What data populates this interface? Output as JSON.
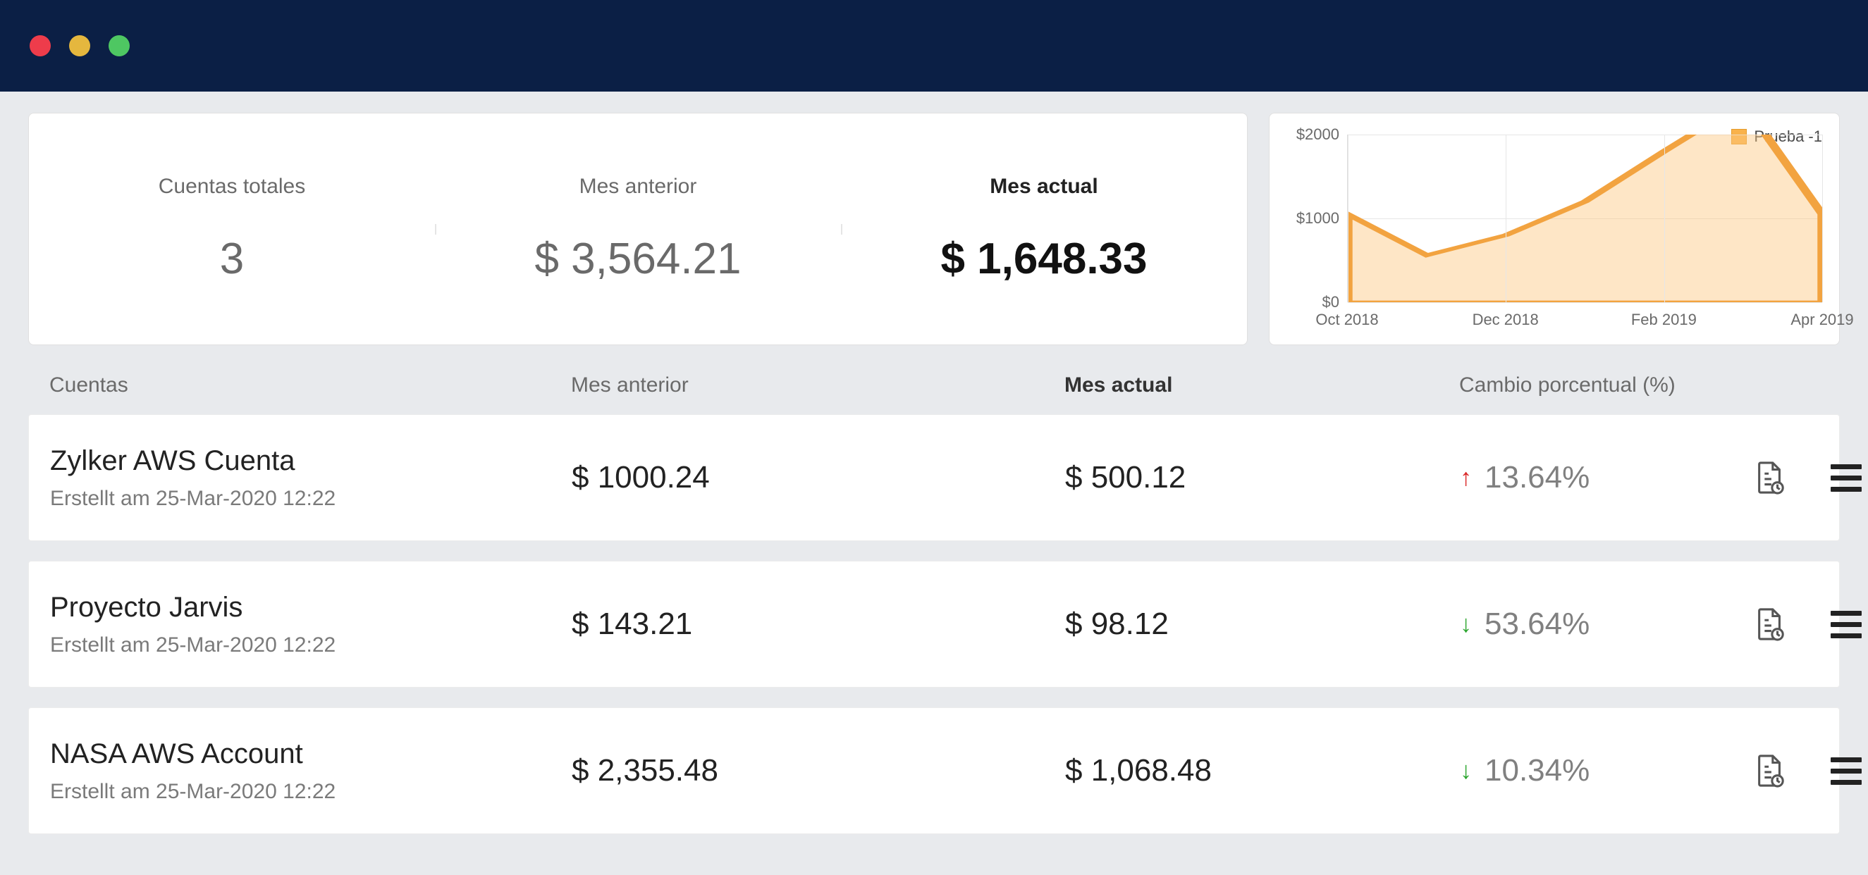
{
  "summary": {
    "total_label": "Cuentas totales",
    "total_value": "3",
    "prev_label": "Mes anterior",
    "prev_value": "$ 3,564.21",
    "curr_label": "Mes actual",
    "curr_value": "$ 1,648.33"
  },
  "chart_data": {
    "type": "area",
    "title": "",
    "xlabel": "",
    "ylabel": "",
    "legend": "Prueba -1",
    "y_ticks": [
      "$0",
      "$1000",
      "$2000"
    ],
    "ylim": [
      0,
      2000
    ],
    "categories": [
      "Oct 2018",
      "Dec 2018",
      "Feb 2019",
      "Apr 2019"
    ],
    "series": [
      {
        "name": "Prueba -1",
        "x": [
          "Oct 2018",
          "Nov 2018",
          "Dec 2018",
          "Jan 2019",
          "Feb 2019",
          "Mar 2019",
          "Apr 2019"
        ],
        "values": [
          1050,
          560,
          800,
          1200,
          1800,
          2380,
          1050
        ]
      }
    ]
  },
  "table": {
    "headers": {
      "accounts": "Cuentas",
      "prev": "Mes anterior",
      "curr": "Mes actual",
      "pct": "Cambio porcentual (%)"
    },
    "rows": [
      {
        "name": "Zylker AWS Cuenta",
        "created": "Erstellt am 25-Mar-2020 12:22",
        "prev": "$ 1000.24",
        "curr": "$ 500.12",
        "dir": "up",
        "pct": "13.64%"
      },
      {
        "name": "Proyecto Jarvis",
        "created": "Erstellt am 25-Mar-2020 12:22",
        "prev": "$ 143.21",
        "curr": "$ 98.12",
        "dir": "down",
        "pct": "53.64%"
      },
      {
        "name": "NASA AWS Account",
        "created": "Erstellt am 25-Mar-2020 12:22",
        "prev": "$ 2,355.48",
        "curr": "$ 1,068.48",
        "dir": "down",
        "pct": "10.34%"
      }
    ]
  }
}
